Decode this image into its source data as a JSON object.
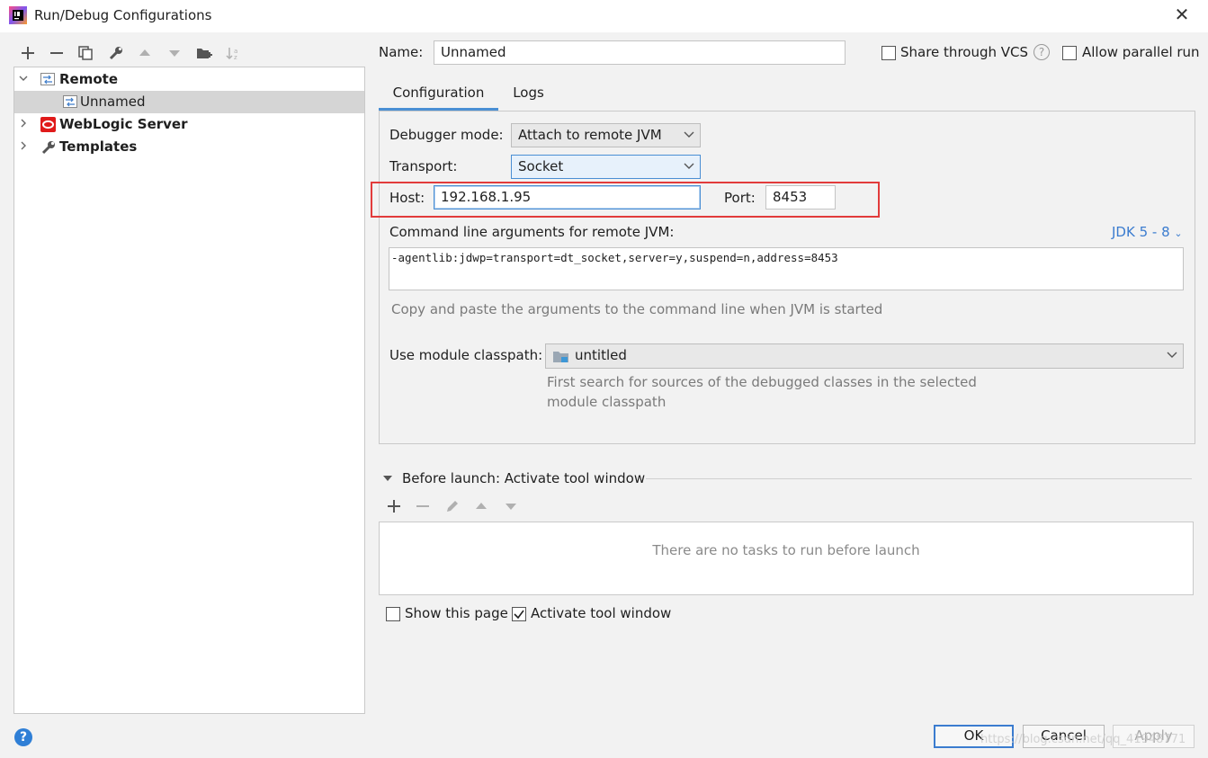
{
  "window": {
    "title": "Run/Debug Configurations",
    "close_glyph": "✕",
    "app_icon": "intellij-icon"
  },
  "toolbar": {
    "items": [
      "add-icon",
      "remove-icon",
      "copy-icon",
      "wrench-icon",
      "move-up-icon",
      "move-down-icon",
      "folder-add-icon",
      "sort-icon"
    ]
  },
  "tree": {
    "items": [
      {
        "label": "Remote",
        "expanded": true,
        "icon": "remote-icon"
      },
      {
        "label": "Unnamed",
        "selected": true,
        "icon": "remote-config-icon"
      },
      {
        "label": "WebLogic Server",
        "expanded": false,
        "icon": "weblogic-icon"
      },
      {
        "label": "Templates",
        "expanded": false,
        "icon": "wrench-icon"
      }
    ]
  },
  "name_row": {
    "label": "Name:",
    "value": "Unnamed",
    "share_vcs": {
      "label": "Share through VCS",
      "checked": false
    },
    "help_glyph": "?",
    "parallel": {
      "label": "Allow parallel run",
      "checked": false
    }
  },
  "tabs": [
    {
      "label": "Configuration",
      "active": true
    },
    {
      "label": "Logs",
      "active": false
    }
  ],
  "config": {
    "debugger_mode": {
      "label": "Debugger mode:",
      "value": "Attach to remote JVM"
    },
    "transport": {
      "label": "Transport:",
      "value": "Socket"
    },
    "host": {
      "label": "Host:",
      "value": "192.168.1.95"
    },
    "port": {
      "label": "Port:",
      "value": "8453"
    },
    "cmd": {
      "label": "Command line arguments for remote JVM:",
      "jdk": "JDK 5 - 8",
      "value": "-agentlib:jdwp=transport=dt_socket,server=y,suspend=n,address=8453",
      "hint": "Copy and paste the arguments to the command line when JVM is started"
    },
    "module": {
      "label": "Use module classpath:",
      "value": "untitled",
      "hint_line1": "First search for sources of the debugged classes in the selected",
      "hint_line2": "module classpath"
    }
  },
  "before_launch": {
    "title": "Before launch: Activate tool window",
    "empty_text": "There are no tasks to run before launch",
    "toolbar": [
      "add-icon",
      "remove-icon",
      "edit-icon",
      "move-up-icon",
      "move-down-icon"
    ]
  },
  "footer": {
    "show_page": {
      "label": "Show this page",
      "checked": false
    },
    "activate": {
      "label": "Activate tool window",
      "checked": true
    },
    "help_glyph": "?",
    "ok": "OK",
    "cancel": "Cancel",
    "apply": "Apply",
    "watermark": "https://blog.csdn.net/qq_41948771"
  },
  "colors": {
    "accent": "#4a8fd4",
    "highlight_box": "#e23b3b",
    "selection": "#d5d5d5"
  }
}
